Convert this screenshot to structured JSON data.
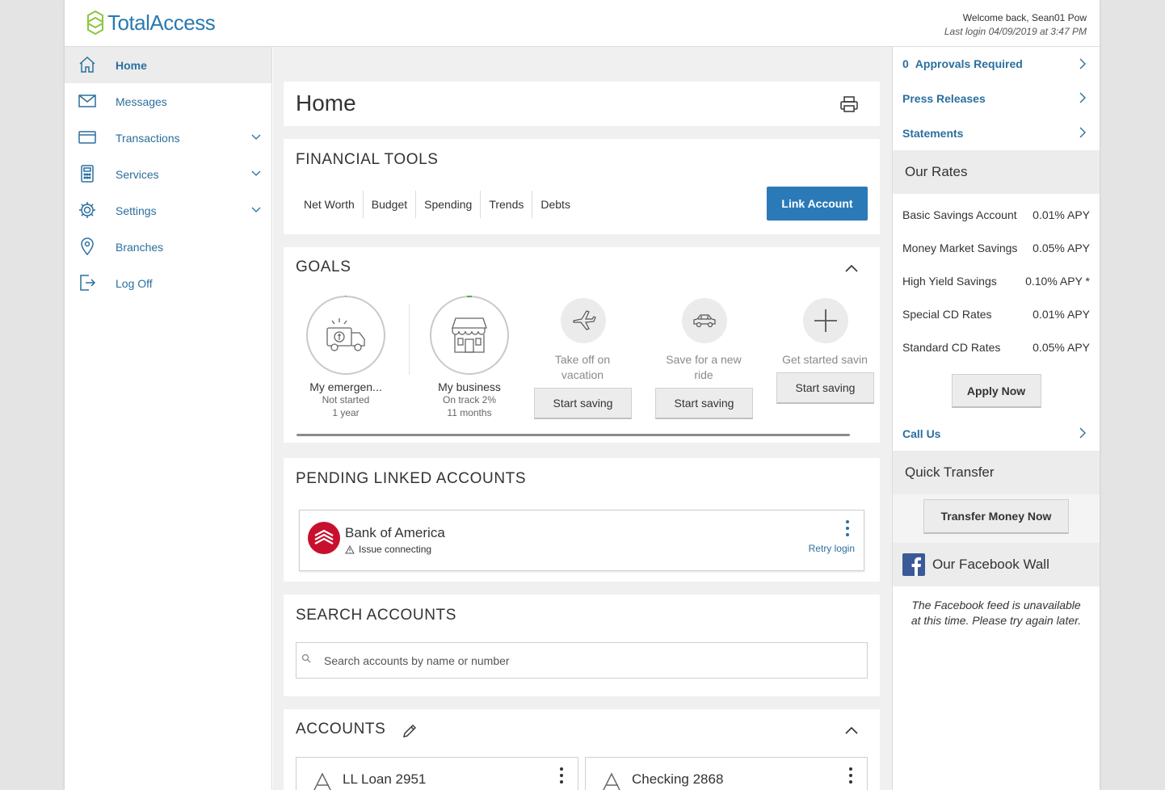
{
  "brand": {
    "name": "TotalAccess",
    "color": "#2a7ab0",
    "mark_color": "#8cc63f"
  },
  "user": {
    "welcome": "Welcome back, Sean01 Pow",
    "last_login": "Last login 04/09/2019 at 3:47 PM"
  },
  "sidebar": {
    "items": [
      {
        "label": "Home",
        "icon": "home-icon",
        "active": true
      },
      {
        "label": "Messages",
        "icon": "envelope-icon"
      },
      {
        "label": "Transactions",
        "icon": "credit-card-icon",
        "expandable": true
      },
      {
        "label": "Services",
        "icon": "calculator-icon",
        "expandable": true
      },
      {
        "label": "Settings",
        "icon": "gear-icon",
        "expandable": true
      },
      {
        "label": "Branches",
        "icon": "map-pin-icon"
      },
      {
        "label": "Log Off",
        "icon": "logout-icon"
      }
    ]
  },
  "main": {
    "page_title": "Home",
    "financial_tools": {
      "title": "FINANCIAL TOOLS",
      "tabs": [
        "Net Worth",
        "Budget",
        "Spending",
        "Trends",
        "Debts"
      ],
      "link_button": "Link Account"
    },
    "goals": {
      "title": "GOALS",
      "active": [
        {
          "name": "My emergen...",
          "status": "Not started",
          "duration": "1 year",
          "icon": "emergency-truck-icon",
          "progress_percent": 0
        },
        {
          "name": "My business",
          "status": "On track 2%",
          "duration": "11 months",
          "icon": "storefront-icon",
          "progress_percent": 2
        }
      ],
      "suggestions": [
        {
          "caption": "Take off on vacation",
          "button": "Start saving",
          "icon": "airplane-icon"
        },
        {
          "caption": "Save for a new ride",
          "button": "Start saving",
          "icon": "car-icon"
        },
        {
          "caption": "Get started savin",
          "button": "Start saving",
          "icon": "plus-icon"
        }
      ]
    },
    "pending": {
      "title": "PENDING LINKED ACCOUNTS",
      "bank": {
        "name": "Bank of America",
        "issue": "Issue connecting",
        "action": "Retry login",
        "logo_color": "#c8102e"
      }
    },
    "search": {
      "title": "SEARCH ACCOUNTS",
      "placeholder": "Search accounts by name or number"
    },
    "accounts": {
      "title": "ACCOUNTS",
      "items": [
        {
          "name": "LL Loan 2951"
        },
        {
          "name": "Checking 2868"
        }
      ]
    }
  },
  "right": {
    "approvals": {
      "count": "0",
      "label": "Approvals Required"
    },
    "press_releases": "Press Releases",
    "statements": "Statements",
    "rates": {
      "title": "Our Rates",
      "rows": [
        {
          "name": "Basic Savings Account",
          "value": "0.01% APY"
        },
        {
          "name": "Money Market Savings",
          "value": "0.05% APY"
        },
        {
          "name": "High Yield Savings",
          "value": "0.10% APY *"
        },
        {
          "name": "Special CD Rates",
          "value": "0.01% APY"
        },
        {
          "name": "Standard CD Rates",
          "value": "0.05% APY"
        }
      ],
      "apply_button": "Apply Now"
    },
    "call_us": "Call Us",
    "quick_transfer": {
      "title": "Quick Transfer",
      "button": "Transfer Money Now"
    },
    "facebook": {
      "title": "Our Facebook Wall",
      "message": "The Facebook feed is unavailable at this time. Please try again later.",
      "color": "#3b5998"
    }
  }
}
